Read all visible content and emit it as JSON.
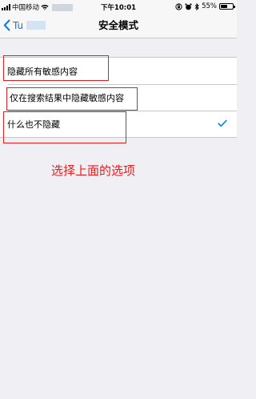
{
  "status_bar": {
    "carrier": "中国移动",
    "time": "下午10:01",
    "battery_percent": "55%",
    "battery_level": 0.55
  },
  "nav": {
    "back_label": "Tu",
    "title": "安全模式"
  },
  "options": [
    {
      "label": "隐藏所有敏感内容",
      "selected": false
    },
    {
      "label": "仅在搜索结果中隐藏敏感内容",
      "selected": false
    },
    {
      "label": "什么也不隐藏",
      "selected": true
    }
  ],
  "annotation": {
    "text": "选择上面的选项",
    "color": "#e02020"
  },
  "colors": {
    "accent": "#007aff",
    "background": "#efeff4"
  }
}
